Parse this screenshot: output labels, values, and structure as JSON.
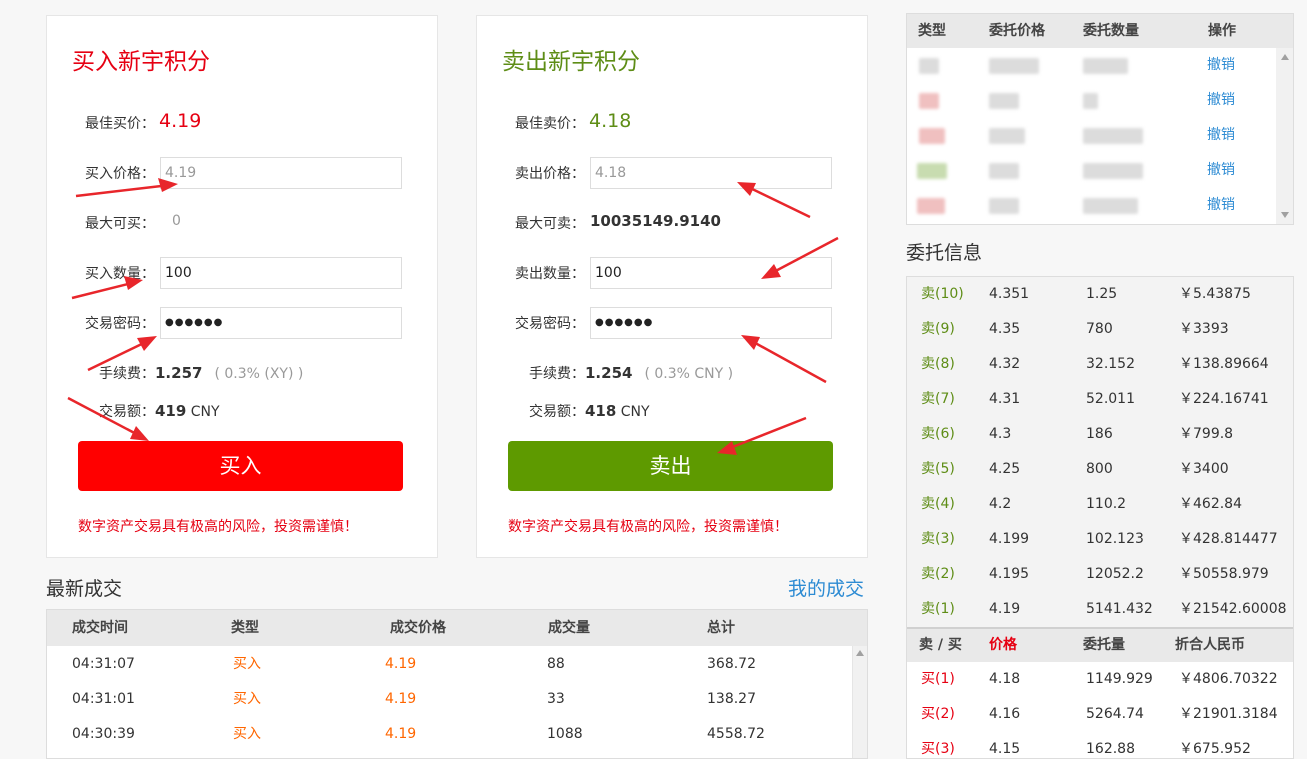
{
  "buy": {
    "title": "买入新宇积分",
    "best_label": "最佳买价：",
    "best_value": "4.19",
    "price_label": "买入价格：",
    "price_placeholder": "4.19",
    "max_label": "最大可买：",
    "max_value": "0",
    "qty_label": "买入数量：",
    "qty_value": "100",
    "pwd_label": "交易密码：",
    "pwd_value": "●●●●●●",
    "fee_label": "手续费：",
    "fee_value": "1.257",
    "fee_note": "( 0.3% (XY) )",
    "amount_label": "交易额：",
    "amount_value": "419",
    "amount_unit": "CNY",
    "button": "买入",
    "risk": "数字资产交易具有极高的风险，投资需谨慎！"
  },
  "sell": {
    "title": "卖出新宇积分",
    "best_label": "最佳卖价：",
    "best_value": "4.18",
    "price_label": "卖出价格：",
    "price_placeholder": "4.18",
    "max_label": "最大可卖：",
    "max_value": "10035149.9140",
    "qty_label": "卖出数量：",
    "qty_value": "100",
    "pwd_label": "交易密码：",
    "pwd_value": "●●●●●●",
    "fee_label": "手续费：",
    "fee_value": "1.254",
    "fee_note": "( 0.3% CNY )",
    "amount_label": "交易额：",
    "amount_value": "418",
    "amount_unit": "CNY",
    "button": "卖出",
    "risk": "数字资产交易具有极高的风险，投资需谨慎！"
  },
  "trades": {
    "title": "最新成交",
    "my_link": "我的成交",
    "headers": [
      "成交时间",
      "类型",
      "成交价格",
      "成交量",
      "总计"
    ],
    "rows": [
      {
        "time": "04:31:07",
        "type": "买入",
        "price": "4.19",
        "qty": "88",
        "total": "368.72"
      },
      {
        "time": "04:31:01",
        "type": "买入",
        "price": "4.19",
        "qty": "33",
        "total": "138.27"
      },
      {
        "time": "04:30:39",
        "type": "买入",
        "price": "4.19",
        "qty": "1088",
        "total": "4558.72"
      }
    ]
  },
  "orders": {
    "headers": [
      "类型",
      "委托价格",
      "委托数量",
      "操作"
    ],
    "cancel_label": "撤销",
    "rows": [
      {
        "type_color": "#c8dcb0",
        "cancel": "撤销"
      },
      {
        "type_color": "#f0c0c0",
        "cancel": "撤销"
      },
      {
        "type_color": "#f0c0c0",
        "cancel": "撤销"
      },
      {
        "type_color": "#c8dcb0",
        "cancel": "撤销"
      },
      {
        "type_color": "#f0c0c0",
        "cancel": "撤销"
      }
    ]
  },
  "book": {
    "title": "委托信息",
    "sells": [
      {
        "label": "卖(10)",
        "price": "4.351",
        "qty": "1.25",
        "total": "￥5.43875"
      },
      {
        "label": "卖(9)",
        "price": "4.35",
        "qty": "780",
        "total": "￥3393"
      },
      {
        "label": "卖(8)",
        "price": "4.32",
        "qty": "32.152",
        "total": "￥138.89664"
      },
      {
        "label": "卖(7)",
        "price": "4.31",
        "qty": "52.011",
        "total": "￥224.16741"
      },
      {
        "label": "卖(6)",
        "price": "4.3",
        "qty": "186",
        "total": "￥799.8"
      },
      {
        "label": "卖(5)",
        "price": "4.25",
        "qty": "800",
        "total": "￥3400"
      },
      {
        "label": "卖(4)",
        "price": "4.2",
        "qty": "110.2",
        "total": "￥462.84"
      },
      {
        "label": "卖(3)",
        "price": "4.199",
        "qty": "102.123",
        "total": "￥428.814477"
      },
      {
        "label": "卖(2)",
        "price": "4.195",
        "qty": "12052.2",
        "total": "￥50558.979"
      },
      {
        "label": "卖(1)",
        "price": "4.19",
        "qty": "5141.432",
        "total": "￥21542.60008"
      }
    ],
    "headers": [
      "卖 / 买",
      "价格",
      "委托量",
      "折合人民币"
    ],
    "buys": [
      {
        "label": "买(1)",
        "price": "4.18",
        "qty": "1149.929",
        "total": "￥4806.70322"
      },
      {
        "label": "买(2)",
        "price": "4.16",
        "qty": "5264.74",
        "total": "￥21901.3184"
      },
      {
        "label": "买(3)",
        "price": "4.15",
        "qty": "162.88",
        "total": "￥675.952"
      }
    ]
  },
  "colors": {
    "buy_red": "#ff0000",
    "sell_green": "#5e9a00",
    "link_blue": "#2d8bd3",
    "annotation_arrow": "#e8262b"
  }
}
